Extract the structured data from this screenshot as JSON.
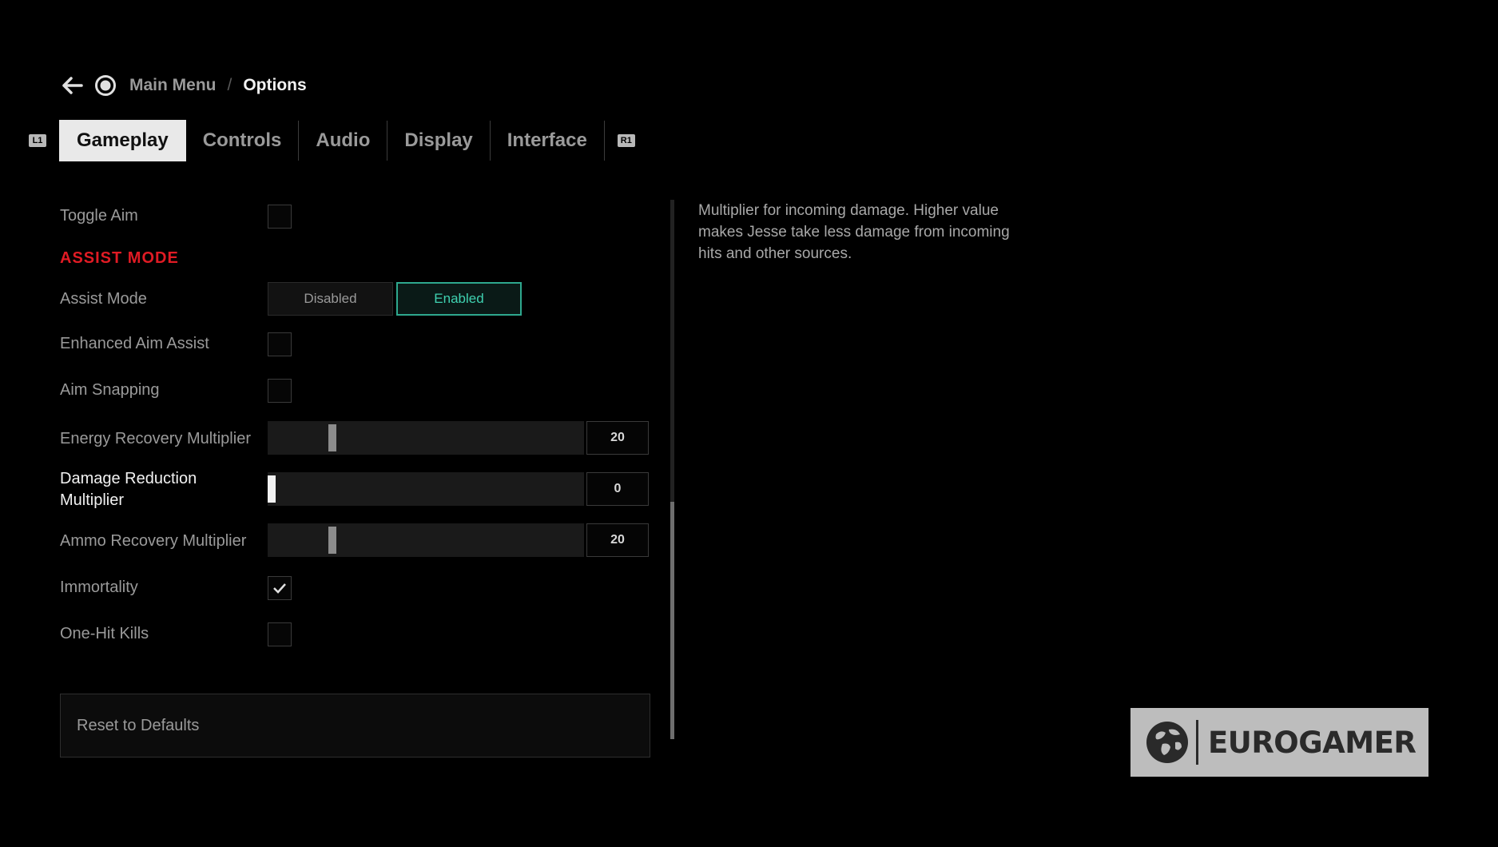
{
  "breadcrumb": {
    "parent": "Main Menu",
    "separator": "/",
    "current": "Options"
  },
  "tabs": {
    "left_bumper": "L1",
    "right_bumper": "R1",
    "items": [
      {
        "label": "Gameplay",
        "active": true
      },
      {
        "label": "Controls"
      },
      {
        "label": "Audio"
      },
      {
        "label": "Display"
      },
      {
        "label": "Interface"
      }
    ]
  },
  "settings": {
    "toggle_aim": {
      "label": "Toggle Aim",
      "checked": false
    },
    "section_title": "ASSIST MODE",
    "assist_mode": {
      "label": "Assist Mode",
      "options": [
        "Disabled",
        "Enabled"
      ],
      "selected": "Enabled"
    },
    "enhanced_aim_assist": {
      "label": "Enhanced Aim Assist",
      "checked": false
    },
    "aim_snapping": {
      "label": "Aim Snapping",
      "checked": false
    },
    "energy_recovery": {
      "label": "Energy Recovery Multiplier",
      "value": "20"
    },
    "damage_reduction": {
      "label_line1": "Damage Reduction",
      "label_line2": "Multiplier",
      "value": "0"
    },
    "ammo_recovery": {
      "label": "Ammo Recovery Multiplier",
      "value": "20"
    },
    "immortality": {
      "label": "Immortality",
      "checked": true
    },
    "one_hit_kills": {
      "label": "One-Hit Kills",
      "checked": false
    }
  },
  "reset_label": "Reset to Defaults",
  "description": "Multiplier for incoming damage. Higher value makes Jesse take less damage from incoming hits and other sources.",
  "watermark": "EUROGAMER",
  "colors": {
    "accent_red": "#e01b24",
    "enabled_teal": "#3fd1b0"
  }
}
